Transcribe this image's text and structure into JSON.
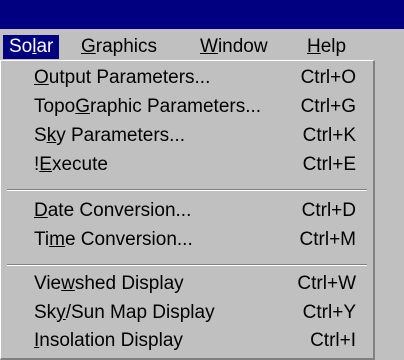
{
  "menubar": {
    "solar": {
      "pre": "So",
      "u": "l",
      "post": "ar"
    },
    "graphics": {
      "pre": "",
      "u": "G",
      "post": "raphics"
    },
    "window": {
      "pre": "",
      "u": "W",
      "post": "indow"
    },
    "help": {
      "pre": "",
      "u": "H",
      "post": "elp"
    }
  },
  "menu": {
    "items": [
      {
        "pre": "",
        "u": "O",
        "post": "utput Parameters...",
        "shortcut": "Ctrl+O"
      },
      {
        "pre": "Topo",
        "u": "G",
        "post": "raphic Parameters...",
        "shortcut": "Ctrl+G"
      },
      {
        "pre": "S",
        "u": "k",
        "post": "y Parameters...",
        "shortcut": "Ctrl+K"
      },
      {
        "pre": "!",
        "u": "E",
        "post": "xecute",
        "shortcut": "Ctrl+E"
      },
      {
        "pre": "",
        "u": "D",
        "post": "ate Conversion...",
        "shortcut": "Ctrl+D"
      },
      {
        "pre": "Ti",
        "u": "m",
        "post": "e Conversion...",
        "shortcut": "Ctrl+M"
      },
      {
        "pre": "Vie",
        "u": "w",
        "post": "shed Display",
        "shortcut": "Ctrl+W"
      },
      {
        "pre": "Sk",
        "u": "y",
        "post": "/Sun Map Display",
        "shortcut": "Ctrl+Y"
      },
      {
        "pre": "",
        "u": "I",
        "post": "nsolation Display",
        "shortcut": "Ctrl+I"
      }
    ]
  },
  "colors": {
    "title_bar": "#000080",
    "menu_background": "#c0c0c0",
    "highlight": "#000080"
  }
}
